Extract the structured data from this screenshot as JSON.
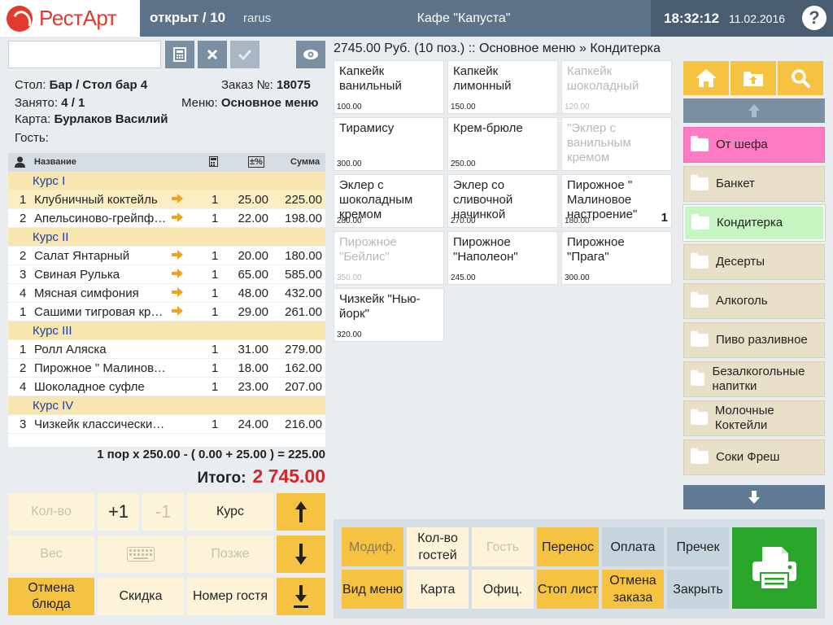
{
  "header": {
    "logo_text": "РестАрт",
    "status": "открыт / 10",
    "user": "rarus",
    "cafe": "Кафе \"Капуста\"",
    "time": "18:32:12",
    "date": "11.02.2016",
    "help_label": "?"
  },
  "search": {
    "value": "",
    "placeholder": ""
  },
  "order": {
    "table_label": "Стол:",
    "table_value": "Бар / Стол бар 4",
    "order_label": "Заказ №:",
    "order_value": "18075",
    "busy_label": "Занято:",
    "busy_value": "4 / 1",
    "menu_label": "Меню:",
    "menu_value": "Основное меню",
    "card_label": "Карта:",
    "card_value": "Бурлаков Василий",
    "guest_label": "Гость:",
    "guest_value": ""
  },
  "order_table": {
    "col_name": "Название",
    "col_discount": "±%",
    "col_sum": "Сумма",
    "rows": [
      {
        "type": "course",
        "label": "Курс I"
      },
      {
        "type": "item",
        "qty": "1",
        "name": "Клубничный коктейль",
        "arrow": true,
        "count": "1",
        "price": "25.00",
        "sum": "225.00",
        "selected": true
      },
      {
        "type": "item",
        "qty": "2",
        "name": "Апельсиново-грейпфрутовый",
        "arrow": true,
        "count": "1",
        "price": "22.00",
        "sum": "198.00"
      },
      {
        "type": "course",
        "label": "Курс II"
      },
      {
        "type": "item",
        "qty": "2",
        "name": "Салат Янтарный",
        "arrow": true,
        "count": "1",
        "price": "20.00",
        "sum": "180.00"
      },
      {
        "type": "item",
        "qty": "3",
        "name": "Свиная Рулька",
        "arrow": true,
        "count": "1",
        "price": "65.00",
        "sum": "585.00"
      },
      {
        "type": "item",
        "qty": "4",
        "name": "Мясная симфония",
        "arrow": true,
        "count": "1",
        "price": "48.00",
        "sum": "432.00"
      },
      {
        "type": "item",
        "qty": "1",
        "name": "Сашими тигровая креветка",
        "arrow": true,
        "count": "1",
        "price": "29.00",
        "sum": "261.00"
      },
      {
        "type": "course",
        "label": "Курс III"
      },
      {
        "type": "item",
        "qty": "1",
        "name": "Ролл Аляска",
        "arrow": false,
        "count": "1",
        "price": "31.00",
        "sum": "279.00"
      },
      {
        "type": "item",
        "qty": "2",
        "name": "Пирожное \" Малиновое настроение\"",
        "arrow": false,
        "count": "1",
        "price": "18.00",
        "sum": "162.00"
      },
      {
        "type": "item",
        "qty": "4",
        "name": "Шоколадное суфле",
        "arrow": false,
        "count": "1",
        "price": "23.00",
        "sum": "207.00"
      },
      {
        "type": "course",
        "label": "Курс IV"
      },
      {
        "type": "item",
        "qty": "3",
        "name": "Чизкейк классический с/п",
        "arrow": false,
        "count": "1",
        "price": "24.00",
        "sum": "216.00"
      }
    ]
  },
  "calc_line": "1 пор x 250.00 - ( 0.00 + 25.00 ) = 225.00",
  "total": {
    "label": "Итого:",
    "value": "2 745.00"
  },
  "left_buttons": {
    "qty": "Кол-во",
    "plus": "+1",
    "minus": "-1",
    "course": "Курс",
    "weight": "Вес",
    "later": "Позже",
    "cancel_dish": "Отмена блюда",
    "discount": "Скидка",
    "guest_number": "Номер гостя"
  },
  "breadcrumb": "2745.00 Руб. (10 поз.)  ::  Основное меню » Кондитерка",
  "menu_items": [
    {
      "name": "Капкейк ванильный",
      "price": "100.00",
      "disabled": false,
      "count": ""
    },
    {
      "name": "Капкейк лимонный",
      "price": "150.00",
      "disabled": false,
      "count": ""
    },
    {
      "name": "Капкейк шоколадный",
      "price": "120.00",
      "disabled": true,
      "count": ""
    },
    {
      "name": "Тирамису",
      "price": "300.00",
      "disabled": false,
      "count": ""
    },
    {
      "name": "Крем-брюле",
      "price": "250.00",
      "disabled": false,
      "count": ""
    },
    {
      "name": "\"Эклер с ванильным кремом",
      "price": "",
      "disabled": true,
      "count": ""
    },
    {
      "name": "Эклер с шоколадным кремом",
      "price": "280.00",
      "disabled": false,
      "count": ""
    },
    {
      "name": "Эклер со сливочной начинкой",
      "price": "270.00",
      "disabled": false,
      "count": ""
    },
    {
      "name": "Пирожное \" Малиновое настроение\"",
      "price": "180.00",
      "disabled": false,
      "count": "1"
    },
    {
      "name": "Пирожное \"Бейлис\"",
      "price": "350.00",
      "disabled": true,
      "count": ""
    },
    {
      "name": "Пирожное \"Наполеон\"",
      "price": "245.00",
      "disabled": false,
      "count": ""
    },
    {
      "name": "Пирожное \"Прага\"",
      "price": "300.00",
      "disabled": false,
      "count": ""
    },
    {
      "name": "Чизкейк \"Нью-йорк\"",
      "price": "320.00",
      "disabled": false,
      "count": ""
    }
  ],
  "categories": [
    {
      "label": "От шефа",
      "style": "pink"
    },
    {
      "label": "Банкет",
      "style": ""
    },
    {
      "label": "Кондитерка",
      "style": "green"
    },
    {
      "label": "Десерты",
      "style": ""
    },
    {
      "label": "Алкоголь",
      "style": ""
    },
    {
      "label": "Пиво разливное",
      "style": ""
    },
    {
      "label": "Безалкогольные напитки",
      "style": ""
    },
    {
      "label": "Молочные Коктейли",
      "style": ""
    },
    {
      "label": "Соки Фреш",
      "style": ""
    }
  ],
  "actions": {
    "modif": "Модиф.",
    "guests_count": "Кол-во гостей",
    "guest": "Гость",
    "transfer": "Перенос",
    "payment": "Оплата",
    "precheck": "Пречек",
    "menu_view": "Вид меню",
    "card": "Карта",
    "waiter": "Офиц.",
    "stop_list": "Стоп лист",
    "cancel_order": "Отмена заказа",
    "close": "Закрыть"
  },
  "colors": {
    "header": "#5d7389",
    "accent_yellow": "#f5c242",
    "total_red": "#d3262a",
    "print_green": "#29a62a",
    "cat_pink": "#ff7bc3",
    "cat_green": "#c7f5c2"
  }
}
